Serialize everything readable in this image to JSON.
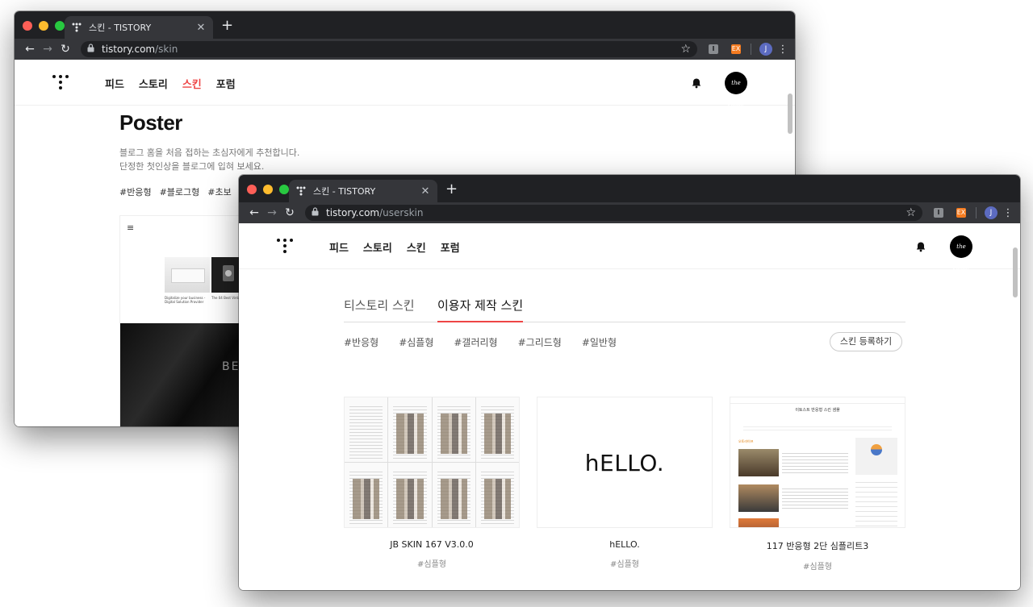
{
  "back_window": {
    "tab_title": "스킨 - TISTORY",
    "url_host": "tistory.com",
    "url_path": "/skin",
    "profile_initial": "J",
    "ext_label": "EX",
    "nav": [
      "피드",
      "스토리",
      "스킨",
      "포럼"
    ],
    "active_nav_index": 2,
    "avatar_text": "the sweet life",
    "skin_title": "Poster",
    "description": [
      "블로그 홈을 처음 접하는 초심자에게 추천합니다.",
      "단정한 첫인상을 블로그에 입혀 보세요."
    ],
    "tags": [
      "#반응형",
      "#블로그형",
      "#초보",
      "#"
    ],
    "preview": {
      "caption_1": "Digitalize your business - Digital Solution Provider",
      "caption_2": "The 04 Best Vintage Ca...",
      "banner_text": "BE"
    }
  },
  "front_window": {
    "tab_title": "스킨 - TISTORY",
    "url_host": "tistory.com",
    "url_path": "/userskin",
    "profile_initial": "J",
    "ext_label": "EX",
    "nav": [
      "피드",
      "스토리",
      "스킨",
      "포럼"
    ],
    "avatar_text": "the sweet life",
    "tabs": [
      "티스토리 스킨",
      "이용자 제작 스킨"
    ],
    "active_tab_index": 1,
    "filters": [
      "#반응형",
      "#심플형",
      "#갤러리형",
      "#그리드형",
      "#일반형"
    ],
    "register_button": "스킨 등록하기",
    "cards": [
      {
        "name": "JB SKIN 167 V3.0.0",
        "tag": "#심플형"
      },
      {
        "name": "hELLO.",
        "tag": "#심플형",
        "thumb_text": "hELLO."
      },
      {
        "name": "117 반응형 2단 심플리트3",
        "tag": "#심플형",
        "thumb_title": "이토스트 반응형 스킨 샘플",
        "thumb_section": "오토라이프"
      }
    ]
  },
  "icons": {
    "favicon": "tistory-logo-icon",
    "back": "back-arrow-icon",
    "forward": "forward-arrow-icon",
    "reload": "reload-icon",
    "lock": "lock-icon",
    "star": "star-icon",
    "bell": "bell-icon",
    "menu": "kebab-menu-icon"
  },
  "colors": {
    "accent": "#ee4545",
    "chrome_dark": "#202124",
    "chrome_toolbar": "#35363a"
  }
}
